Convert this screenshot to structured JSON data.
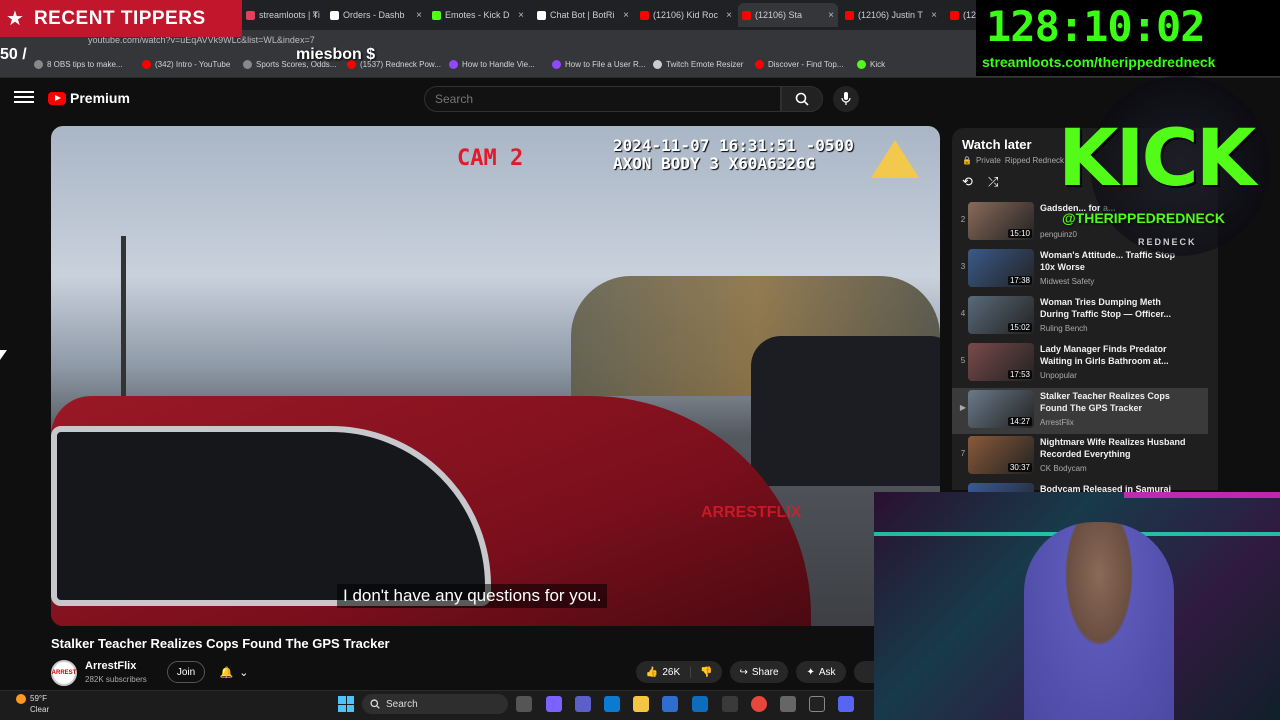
{
  "browser": {
    "tabs": [
      {
        "label": "streamloots | Ti",
        "color": "#e0415d"
      },
      {
        "label": "Orders - Dashb",
        "color": "#ffffff"
      },
      {
        "label": "Emotes - Kick D",
        "color": "#53fc18"
      },
      {
        "label": "Chat Bot | BotRi",
        "color": "#ffffff"
      },
      {
        "label": "(12106) Kid Roc",
        "color": "#ff0000"
      },
      {
        "label": "(12106) Sta",
        "color": "#ff0000",
        "active": true
      },
      {
        "label": "(12106) Justin T",
        "color": "#ff0000"
      },
      {
        "label": "(12106",
        "color": "#ff0000"
      }
    ],
    "url": "youtube.com/watch?v=uEqAVVk9WLc&list=WL&index=7",
    "bookmarks": [
      {
        "label": "8 OBS tips to make...",
        "color": "#888888"
      },
      {
        "label": "(342) Intro - YouTube",
        "color": "#ff0000"
      },
      {
        "label": "Sports Scores, Odds...",
        "color": "#888888"
      },
      {
        "label": "(1537) Redneck Pow...",
        "color": "#ff0000"
      },
      {
        "label": "How to Handle Vie...",
        "color": "#9146ff"
      },
      {
        "label": "How to File a User R...",
        "color": "#9146ff"
      },
      {
        "label": "Twitch Emote Resizer",
        "color": "#cccccc"
      },
      {
        "label": "Discover - Find Top...",
        "color": "#ff0000"
      },
      {
        "label": "Kick",
        "color": "#53fc18"
      }
    ]
  },
  "overlays": {
    "recent_tippers": "RECENT TIPPERS",
    "tipper_name": "miesbon $",
    "left_snippet": "50 /",
    "timer": "128:10:02",
    "timer_link": "streamloots.com/therippedredneck",
    "kick": "KICK",
    "kick_handle": "@THERIPPEDREDNECK",
    "badge_text": "REDNECK"
  },
  "youtube": {
    "logo_text": "Premium",
    "search_placeholder": "Search",
    "video": {
      "cam_label": "CAM 2",
      "timestamp": "2024-11-07 16:31:51 -0500",
      "device": "AXON BODY 3 X60A6326G",
      "subtitle": "I don't have any questions for you.",
      "watermark": "ARRESTFLIX"
    },
    "title": "Stalker Teacher Realizes Cops Found The GPS Tracker",
    "channel": {
      "name": "ArrestFlix",
      "subscribers": "282K subscribers",
      "avatar_text": "ARREST"
    },
    "actions": {
      "join": "Join",
      "likes": "26K",
      "share": "Share",
      "ask": "Ask"
    },
    "playlist": {
      "title": "Watch later",
      "privacy": "Private",
      "owner": "Ripped Redneck",
      "items": [
        {
          "index": "2",
          "title": "Gadsden... for a...",
          "channel": "penguinz0",
          "duration": "15:10",
          "thumb": "#8a6a5a"
        },
        {
          "index": "3",
          "title": "Woman's Attitude... Traffic Stop 10x Worse",
          "channel": "Midwest Safety",
          "duration": "17:38",
          "thumb": "#3a5a8a"
        },
        {
          "index": "4",
          "title": "Woman Tries Dumping Meth During Traffic Stop — Officer...",
          "channel": "Ruling Bench",
          "duration": "15:02",
          "thumb": "#5a6a7a"
        },
        {
          "index": "5",
          "title": "Lady Manager Finds Predator Waiting in Girls Bathroom at...",
          "channel": "Unpopular",
          "duration": "17:53",
          "thumb": "#7a4a4a"
        },
        {
          "index": "▶",
          "title": "Stalker Teacher Realizes Cops Found The GPS Tracker",
          "channel": "ArrestFlix",
          "duration": "14:27",
          "thumb": "#6a7a8a",
          "current": true
        },
        {
          "index": "7",
          "title": "Nightmare Wife Realizes Husband Recorded Everything",
          "channel": "CK Bodycam",
          "duration": "30:37",
          "thumb": "#8a5a3a"
        },
        {
          "index": "8",
          "title": "Bodycam Released in Samurai",
          "channel": "",
          "duration": "",
          "thumb": "#3a5a9a"
        }
      ]
    }
  },
  "taskbar": {
    "temp": "59°F",
    "condition": "Clear",
    "search": "Search"
  }
}
